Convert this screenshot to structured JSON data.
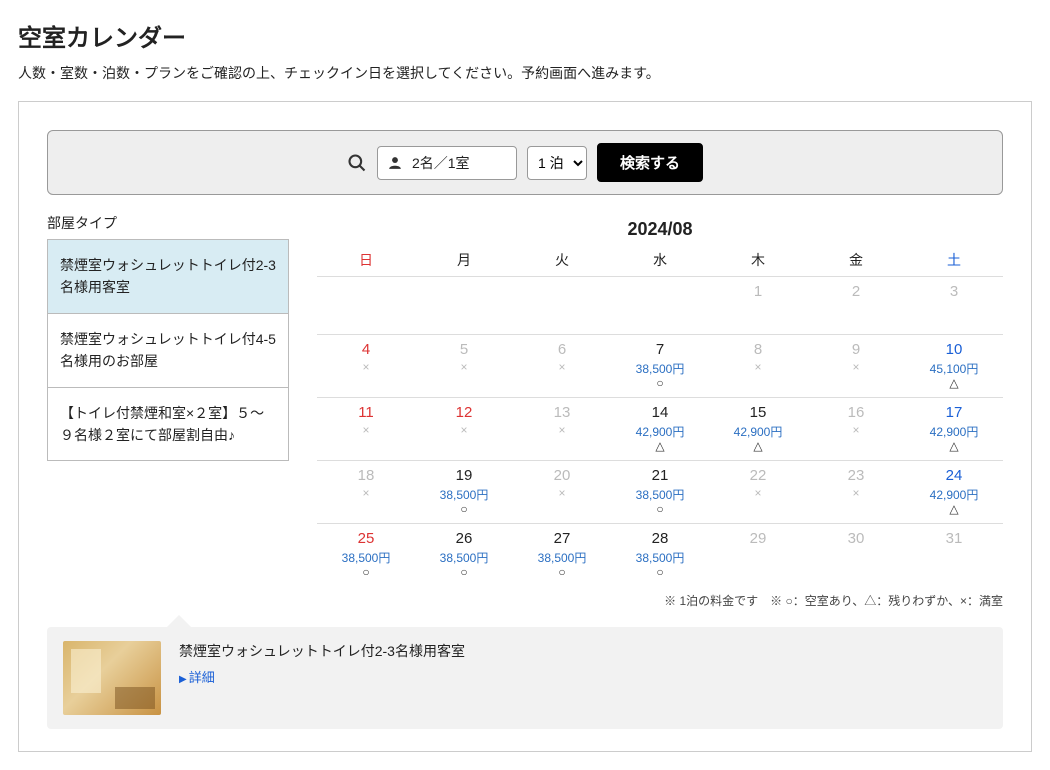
{
  "heading": "空室カレンダー",
  "subtitle": "人数・室数・泊数・プランをご確認の上、チェックイン日を選択してください。予約画面へ進みます。",
  "search": {
    "guests": "2名／1室",
    "nights": "1 泊",
    "button": "検索する"
  },
  "sidebar": {
    "title": "部屋タイプ",
    "items": [
      {
        "label": "禁煙室ウォシュレットトイレ付2-3名様用客室",
        "selected": true
      },
      {
        "label": "禁煙室ウォシュレットトイレ付4-5名様用のお部屋",
        "selected": false
      },
      {
        "label": "【トイレ付禁煙和室×２室】５～９名様２室にて部屋割自由♪",
        "selected": false
      }
    ]
  },
  "calendar": {
    "month": "2024/08",
    "dow": [
      "日",
      "月",
      "火",
      "水",
      "木",
      "金",
      "土"
    ],
    "weeks": [
      [
        {
          "d": "",
          "t": "blank"
        },
        {
          "d": "",
          "t": "blank"
        },
        {
          "d": "",
          "t": "blank"
        },
        {
          "d": "",
          "t": "blank"
        },
        {
          "d": "1",
          "t": "past"
        },
        {
          "d": "2",
          "t": "past"
        },
        {
          "d": "3",
          "t": "past",
          "sat": true
        }
      ],
      [
        {
          "d": "4",
          "t": "x",
          "sun": true
        },
        {
          "d": "5",
          "t": "x",
          "dis": true
        },
        {
          "d": "6",
          "t": "x",
          "dis": true
        },
        {
          "d": "7",
          "t": "price",
          "p": "38,500円",
          "m": "○"
        },
        {
          "d": "8",
          "t": "x",
          "dis": true
        },
        {
          "d": "9",
          "t": "x",
          "dis": true
        },
        {
          "d": "10",
          "t": "price",
          "p": "45,100円",
          "m": "△",
          "sat": true
        }
      ],
      [
        {
          "d": "11",
          "t": "x",
          "sun": true
        },
        {
          "d": "12",
          "t": "x",
          "sun": true
        },
        {
          "d": "13",
          "t": "x",
          "dis": true
        },
        {
          "d": "14",
          "t": "price",
          "p": "42,900円",
          "m": "△"
        },
        {
          "d": "15",
          "t": "price",
          "p": "42,900円",
          "m": "△"
        },
        {
          "d": "16",
          "t": "x",
          "dis": true
        },
        {
          "d": "17",
          "t": "price",
          "p": "42,900円",
          "m": "△",
          "sat": true
        }
      ],
      [
        {
          "d": "18",
          "t": "x",
          "dis": true
        },
        {
          "d": "19",
          "t": "price",
          "p": "38,500円",
          "m": "○"
        },
        {
          "d": "20",
          "t": "x",
          "dis": true
        },
        {
          "d": "21",
          "t": "price",
          "p": "38,500円",
          "m": "○"
        },
        {
          "d": "22",
          "t": "x",
          "dis": true
        },
        {
          "d": "23",
          "t": "x",
          "dis": true
        },
        {
          "d": "24",
          "t": "price",
          "p": "42,900円",
          "m": "△",
          "sat": true
        }
      ],
      [
        {
          "d": "25",
          "t": "price",
          "p": "38,500円",
          "m": "○",
          "sun": true
        },
        {
          "d": "26",
          "t": "price",
          "p": "38,500円",
          "m": "○"
        },
        {
          "d": "27",
          "t": "price",
          "p": "38,500円",
          "m": "○"
        },
        {
          "d": "28",
          "t": "price",
          "p": "38,500円",
          "m": "○"
        },
        {
          "d": "29",
          "t": "past"
        },
        {
          "d": "30",
          "t": "past"
        },
        {
          "d": "31",
          "t": "past",
          "sat": true
        }
      ]
    ],
    "legend": "※ 1泊の料金です　※ ○：空室あり、△：残りわずか、×：満室"
  },
  "detail": {
    "title": "禁煙室ウォシュレットトイレ付2-3名様用客室",
    "link": "詳細"
  }
}
